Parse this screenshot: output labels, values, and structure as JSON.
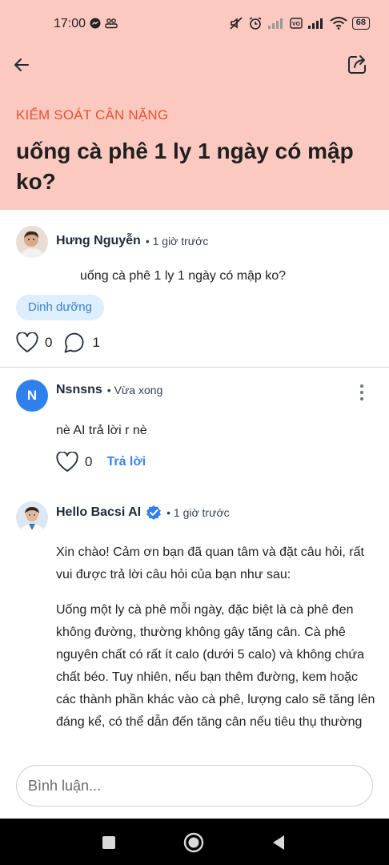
{
  "status_bar": {
    "time": "17:00",
    "battery": "68"
  },
  "header": {
    "category": "KIỂM SOÁT CÂN NẶNG",
    "title": "uống cà phê 1 ly 1 ngày có mập ko?",
    "bg_color": "#fbc9c0",
    "category_color": "#e5532f"
  },
  "post": {
    "author": "Hưng Nguyễn",
    "time_ago": "• 1 giờ trước",
    "body": "uống cà phê 1 ly 1 ngày có mập ko?",
    "tag": "Dinh dưỡng",
    "likes": "0",
    "comments": "1"
  },
  "comments": [
    {
      "avatar_letter": "N",
      "author": "Nsnsns",
      "time_ago": "• Vừa xong",
      "body": "nè AI trả lời r nè",
      "likes": "0",
      "reply_label": "Trả lời"
    }
  ],
  "ai_reply": {
    "author": "Hello Bacsi AI",
    "time_ago": "• 1 giờ trước",
    "paragraph1": "Xin chào! Cảm ơn bạn đã quan tâm và đặt câu hỏi, rất vui được trả lời câu hỏi của bạn như sau:",
    "paragraph2": "Uống một ly cà phê mỗi ngày, đặc biệt là cà phê đen không đường, thường không gây tăng cân. Cà phê nguyên chất có rất ít calo (dưới 5 calo) và không chứa chất béo. Tuy nhiên, nếu bạn thêm đường, kem hoặc các thành phần khác vào cà phê, lượng calo sẽ tăng lên đáng kể, có thể dẫn đến tăng cân nếu tiêu thụ thường"
  },
  "composer": {
    "placeholder": "Bình luận..."
  },
  "colors": {
    "accent_blue": "#3b82f6",
    "tag_bg": "#ddeefc",
    "avatar_n": "#2f80ed"
  }
}
